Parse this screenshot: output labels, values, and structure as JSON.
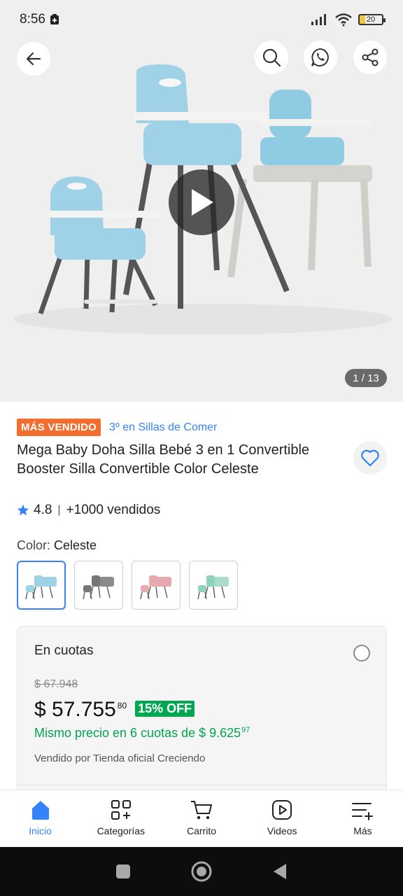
{
  "status_bar": {
    "time": "8:56",
    "battery": "20"
  },
  "hero": {
    "image_counter": "1 / 13"
  },
  "product": {
    "best_seller_badge": "MÁS VENDIDO",
    "rank_text": "3º en Sillas de Comer",
    "title": "Mega Baby Doha Silla Bebé 3 en 1 Convertible Booster Silla Convertible Color Celeste",
    "rating": "4.8",
    "separator": "|",
    "sold_count": "+1000 vendidos"
  },
  "color_selector": {
    "label": "Color:",
    "selected_value": "Celeste",
    "options": [
      "celeste",
      "gris",
      "rosa",
      "verde"
    ]
  },
  "price_card": {
    "title": "En cuotas",
    "original_price": "$ 67.948",
    "price": "$ 57.755",
    "price_cents": "80",
    "discount": "15% OFF",
    "installments_text": "Mismo precio en 6 cuotas de $ 9.625",
    "installments_cents": "97",
    "sold_by": "Vendido por Tienda oficial Creciendo"
  },
  "bottom_nav": {
    "items": [
      {
        "label": "Inicio",
        "icon": "home-icon",
        "active": true
      },
      {
        "label": "Categorías",
        "icon": "categories-icon",
        "active": false
      },
      {
        "label": "Carrito",
        "icon": "cart-icon",
        "active": false
      },
      {
        "label": "Videos",
        "icon": "videos-icon",
        "active": false
      },
      {
        "label": "Más",
        "icon": "more-icon",
        "active": false
      }
    ]
  },
  "colors": {
    "accent_blue": "#3483fa",
    "best_seller_orange": "#f36d2f",
    "discount_green": "#00a650"
  }
}
